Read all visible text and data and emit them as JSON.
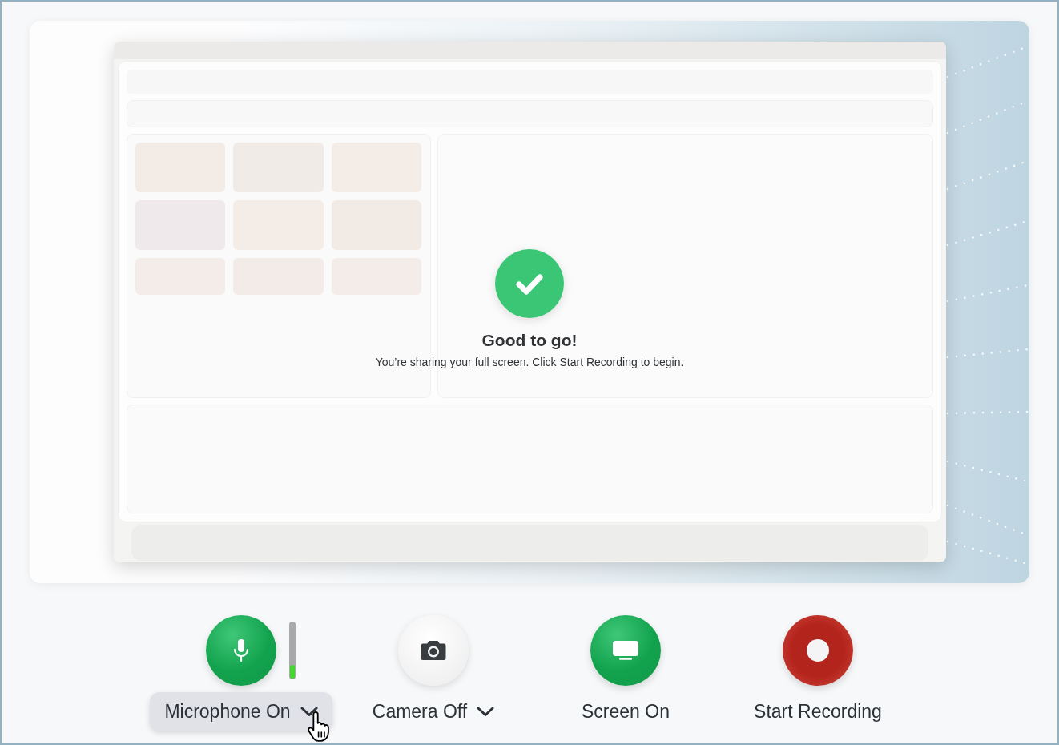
{
  "preview": {
    "overlay": {
      "title": "Good to go!",
      "message": "You’re sharing your full screen. Click Start Recording to begin."
    }
  },
  "controls": [
    {
      "kind": "microphone",
      "label": "Microphone On",
      "on": true,
      "menu": true,
      "hovered": true,
      "level": 0.25
    },
    {
      "kind": "camera",
      "label": "Camera Off",
      "on": false,
      "menu": true,
      "hovered": false
    },
    {
      "kind": "screen",
      "label": "Screen On",
      "on": true
    },
    {
      "kind": "record",
      "label": "Start Recording"
    }
  ]
}
